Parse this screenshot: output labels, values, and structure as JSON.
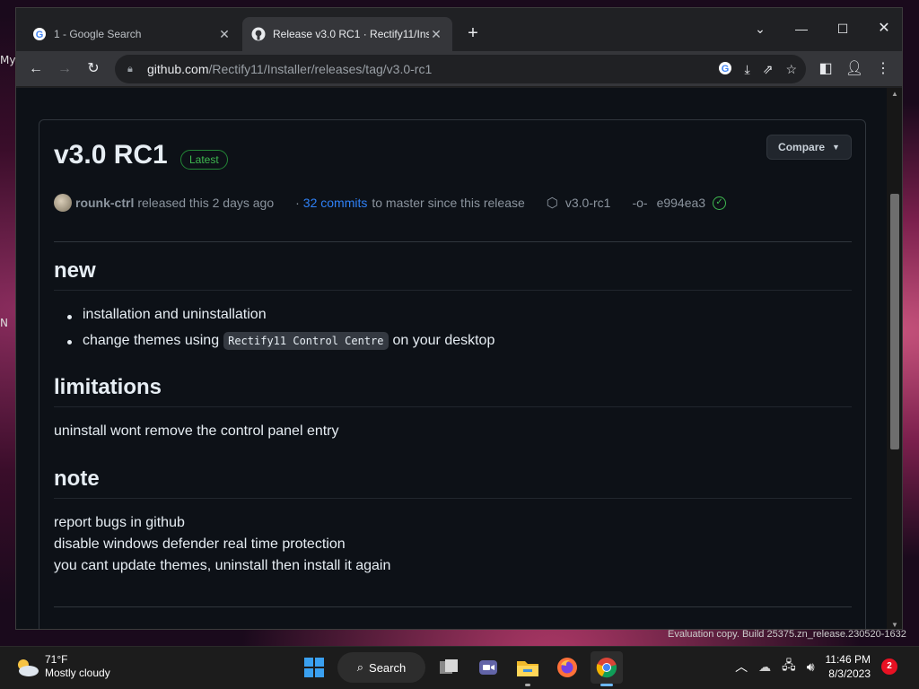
{
  "desktop_edge": {
    "label1": "My",
    "label2": "N"
  },
  "browser": {
    "tabs": [
      {
        "title": "1 - Google Search"
      },
      {
        "title": "Release v3.0 RC1 · Rectify11/Installer"
      }
    ],
    "url": {
      "host": "github.com",
      "path": "/Rectify11/Installer/releases/tag/v3.0-rc1"
    }
  },
  "release": {
    "title": "v3.0 RC1",
    "badge": "Latest",
    "compare_label": "Compare",
    "author": "rounk-ctrl",
    "released_text": "released this 2 days ago",
    "commits_dot": "·",
    "commits_link": "32 commits",
    "commits_suffix": "to master since this release",
    "tag": "v3.0-rc1",
    "commit_sha": "e994ea3",
    "sections": {
      "new": {
        "heading": "new",
        "items": [
          "installation and uninstallation",
          "change themes using",
          "Rectify11 Control Centre",
          "on your desktop"
        ]
      },
      "limitations": {
        "heading": "limitations",
        "text": "uninstall wont remove the control panel entry"
      },
      "note": {
        "heading": "note",
        "lines": [
          "report bugs in github",
          "disable windows defender real time protection",
          "you cant update themes, uninstall then install it again"
        ]
      }
    }
  },
  "watermark": "Evaluation copy. Build 25375.zn_release.230520-1632",
  "taskbar": {
    "weather_temp": "71°F",
    "weather_desc": "Mostly cloudy",
    "search_label": "Search",
    "time": "11:46 PM",
    "date": "8/3/2023",
    "notification_count": "2"
  }
}
